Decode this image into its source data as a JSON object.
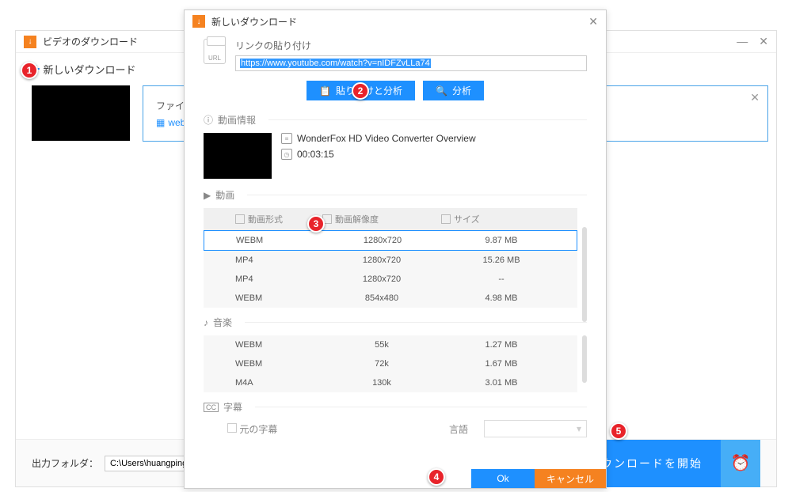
{
  "bg": {
    "title": "ビデオのダウンロード",
    "new_download": "新しいダウンロード",
    "file_label": "ファイ",
    "file_badge": "web",
    "output_label": "出力フォルダ：",
    "output_path": "C:\\Users\\huangping\\Docum",
    "start_download": "ダウンロードを開始"
  },
  "modal": {
    "title": "新しいダウンロード",
    "url_icon_label": "URL",
    "link_label": "リンクの貼り付け",
    "url": "https://www.youtube.com/watch?v=nIDFZvLLa74",
    "paste_analyze": "貼り付けと分析",
    "analyze": "分析",
    "video_info_label": "動画情報",
    "video_title": "WonderFox HD Video Converter Overview",
    "duration": "00:03:15",
    "section_video": "動画",
    "col_format": "動画形式",
    "col_resolution": "動画解像度",
    "col_size": "サイズ",
    "video_rows": [
      {
        "fmt": "WEBM",
        "res": "1280x720",
        "size": "9.87 MB",
        "sel": true
      },
      {
        "fmt": "MP4",
        "res": "1280x720",
        "size": "15.26 MB",
        "sel": false
      },
      {
        "fmt": "MP4",
        "res": "1280x720",
        "size": "--",
        "sel": false
      },
      {
        "fmt": "WEBM",
        "res": "854x480",
        "size": "4.98 MB",
        "sel": false
      }
    ],
    "section_audio": "音楽",
    "audio_rows": [
      {
        "fmt": "WEBM",
        "res": "55k",
        "size": "1.27 MB"
      },
      {
        "fmt": "WEBM",
        "res": "72k",
        "size": "1.67 MB"
      },
      {
        "fmt": "M4A",
        "res": "130k",
        "size": "3.01 MB"
      }
    ],
    "section_subtitle": "字幕",
    "subtitle_original": "元の字幕",
    "language_label": "言語",
    "ok": "Ok",
    "cancel": "キャンセル"
  },
  "steps": {
    "1": "1",
    "2": "2",
    "3": "3",
    "4": "4",
    "5": "5"
  }
}
